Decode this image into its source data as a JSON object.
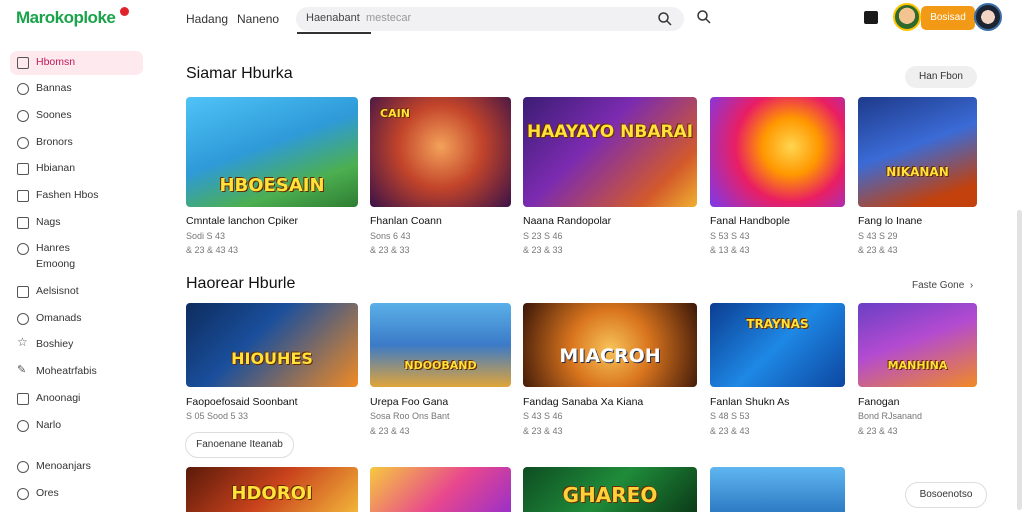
{
  "header": {
    "logo": "Marokoploke",
    "nav": [
      "Hadang",
      "Naneno"
    ],
    "search_value": "Haenabant",
    "search_placeholder": "mestecar",
    "login_label": "Bosisad"
  },
  "sidebar": {
    "items": [
      {
        "label": "Hbomsn",
        "active": true
      },
      {
        "label": "Bannas"
      },
      {
        "label": "Soones"
      },
      {
        "label": "Bronors"
      },
      {
        "label": "Hbianan"
      },
      {
        "label": "Fashen Hbos"
      },
      {
        "label": "Nags"
      },
      {
        "label": "Hanres",
        "sub": "Emoong"
      },
      {
        "label": "Aelsisnot"
      },
      {
        "label": "Omanads"
      },
      {
        "label": "Boshiey"
      },
      {
        "label": "Moheatrfabis"
      },
      {
        "label": "Anoonagi"
      },
      {
        "label": "Narlo"
      },
      {
        "label": "Menoanjars"
      },
      {
        "label": "Ores"
      }
    ]
  },
  "sections": [
    {
      "title": "Siamar Hburka",
      "action": "Han Fbon",
      "cards": [
        {
          "art": "HBOESAIN",
          "title": "Cmntale lanchon Cpiker",
          "meta1": "Sodi S 43",
          "meta2": "& 23 & 43 43"
        },
        {
          "art": "CAIN",
          "title": "Fhanlan Coann",
          "meta1": "Sons 6 43",
          "meta2": "& 23 & 33"
        },
        {
          "art": "HAAYAYO NBARAI",
          "title": "Naana Randopolar",
          "meta1": "S 23 S 46",
          "meta2": "& 23 & 33"
        },
        {
          "art": "",
          "title": "Fanal Handbople",
          "meta1": "S 53 S 43",
          "meta2": "& 13 & 43"
        },
        {
          "art": "NIKANAN",
          "title": "Fang lo Inane",
          "meta1": "S 43 S 29",
          "meta2": "& 23 & 43"
        }
      ]
    },
    {
      "title": "Haorear Hburle",
      "action": "Faste Gone",
      "cards": [
        {
          "art": "HIOUHES",
          "title": "Faopoefosaid Soonbant",
          "meta1": "S 05 Sood 5 33",
          "meta2": ""
        },
        {
          "art": "NDOOBAND",
          "title": "Urepa Foo Gana",
          "meta1": "Sosa Roo Ons Bant",
          "meta2": "& 23 & 43"
        },
        {
          "art": "MIACROH",
          "title": "Fandag Sanaba Xa Kiana",
          "meta1": "S 43 S 46",
          "meta2": "& 23 & 43"
        },
        {
          "art": "TRAYNAS",
          "title": "Fanlan Shukn As",
          "meta1": "S 48 S 53",
          "meta2": "& 23 & 43"
        },
        {
          "art": "MANHINA",
          "title": "Fanogan",
          "meta1": "Bond RJsanand",
          "meta2": "& 23 & 43"
        }
      ]
    },
    {
      "cards": [
        {
          "art": "HDOROI"
        },
        {
          "art": ""
        },
        {
          "art": "GHAREO"
        },
        {
          "art": ""
        }
      ]
    }
  ],
  "load_more_label": "Fanoenane Iteanab",
  "float_button_label": "Bosoenotso",
  "colors": {
    "brand": "#1aa34a",
    "accent": "#f29a16",
    "active_bg": "#fde9ee"
  }
}
